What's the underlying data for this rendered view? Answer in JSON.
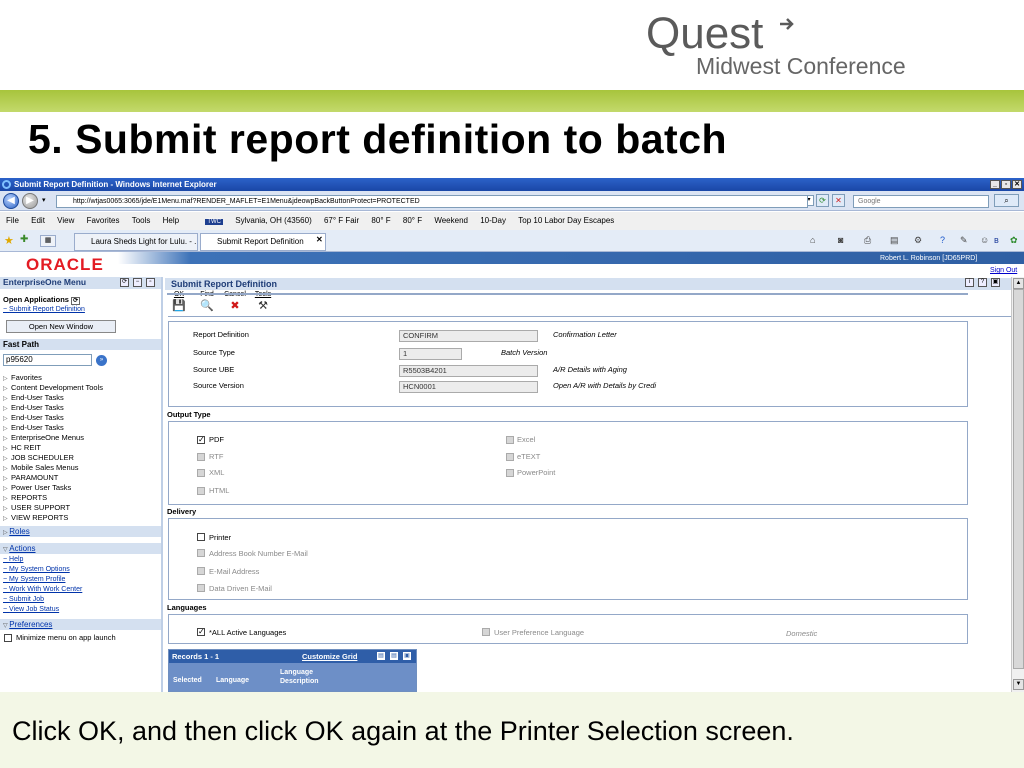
{
  "slide": {
    "logo_word": "Quest",
    "logo_sub": "Midwest Conference",
    "title": "5. Submit report definition to batch",
    "caption": "Click OK, and then click OK again at the Printer Selection screen."
  },
  "browser": {
    "window_title": "Submit Report Definition - Windows Internet Explorer",
    "url": "http://wtjas0065:3065/jde/E1Menu.maf?RENDER_MAFLET=E1Menu&jdeowpBackButtonProtect=PROTECTED",
    "search_placeholder": "Google",
    "menu": [
      "File",
      "Edit",
      "View",
      "Favorites",
      "Tools",
      "Help"
    ],
    "links": [
      "Sylvania, OH (43560)",
      "67° F Fair",
      "80° F",
      "80° F",
      "Weekend",
      "10-Day",
      "Top 10 Labor Day Escapes"
    ],
    "tabs": [
      {
        "label": "Laura Sheds Light for Lulu. - ...",
        "active": false
      },
      {
        "label": "Submit Report Definition",
        "active": true
      }
    ]
  },
  "header": {
    "oracle": "ORACLE",
    "user": "Robert L. Robinson [JD65PRD]",
    "sign_out": "Sign Out"
  },
  "menu": {
    "title": "EnterpriseOne Menu",
    "open_apps": "Open Applications",
    "open_app_item": "Submit Report Definition",
    "open_new_window": "Open New Window",
    "fast_path_label": "Fast Path",
    "fast_path_value": "p95620",
    "tree": [
      "Favorites",
      "Content Development Tools",
      "End-User Tasks",
      "End-User Tasks",
      "End-User Tasks",
      "End-User Tasks",
      "EnterpriseOne Menus",
      "HC REIT",
      "JOB SCHEDULER",
      "Mobile Sales Menus",
      "PARAMOUNT",
      "Power User Tasks",
      "REPORTS",
      "USER SUPPORT",
      "VIEW REPORTS"
    ],
    "roles": "Roles",
    "actions": "Actions",
    "action_links": [
      "Help",
      "My System Options",
      "My System Profile",
      "Work With Work Center",
      "Submit Job",
      "View Job Status"
    ],
    "preferences": "Preferences",
    "minimize_label": "Minimize menu on app launch"
  },
  "form": {
    "title": "Submit Report Definition",
    "toolbar": [
      {
        "label": "OK",
        "glyph": "💾",
        "icon": "save-icon"
      },
      {
        "label": "Find",
        "glyph": "🔍",
        "icon": "find-icon"
      },
      {
        "label": "Cancel",
        "glyph": "✖",
        "icon": "cancel-icon"
      },
      {
        "label": "Tools",
        "glyph": "⚒",
        "icon": "tools-icon"
      }
    ],
    "fields": {
      "report_definition_label": "Report Definition",
      "report_definition": "CONFIRM",
      "report_definition_desc": "Confirmation Letter",
      "source_type_label": "Source Type",
      "source_type": "1",
      "source_type_desc": "Batch Version",
      "source_ube_label": "Source UBE",
      "source_ube": "R5503B4201",
      "source_ube_desc": "A/R Details with Aging",
      "source_version_label": "Source Version",
      "source_version": "HCN0001",
      "source_version_desc": "Open A/R with Details by Credi"
    },
    "output_type": {
      "label": "Output Type",
      "options": [
        {
          "label": "PDF",
          "checked": true,
          "enabled": true
        },
        {
          "label": "RTF",
          "checked": false,
          "enabled": false
        },
        {
          "label": "XML",
          "checked": false,
          "enabled": false
        },
        {
          "label": "HTML",
          "checked": false,
          "enabled": false
        },
        {
          "label": "Excel",
          "checked": false,
          "enabled": false
        },
        {
          "label": "eTEXT",
          "checked": false,
          "enabled": false
        },
        {
          "label": "PowerPoint",
          "checked": false,
          "enabled": false
        }
      ]
    },
    "delivery": {
      "label": "Delivery",
      "options": [
        {
          "label": "Printer",
          "checked": false,
          "enabled": true
        },
        {
          "label": "Address Book Number E-Mail",
          "checked": false,
          "enabled": false
        },
        {
          "label": "E-Mail Address",
          "checked": false,
          "enabled": false
        },
        {
          "label": "Data Driven E-Mail",
          "checked": false,
          "enabled": false
        }
      ]
    },
    "languages": {
      "label": "Languages",
      "all_active": "*ALL Active Languages",
      "user_pref": "User Preference Language",
      "domestic": "Domestic"
    },
    "grid": {
      "records": "Records 1 - 1",
      "customize": "Customize Grid",
      "columns": [
        "Selected",
        "Language",
        "Language Description"
      ]
    }
  },
  "colors": {
    "slide_green": "#a7c43c",
    "ie_title_blue": "#1a47a6",
    "oracle_red": "#e31b23",
    "jde_blue": "#2f5fa3",
    "panel_header": "#d4e0f0"
  }
}
